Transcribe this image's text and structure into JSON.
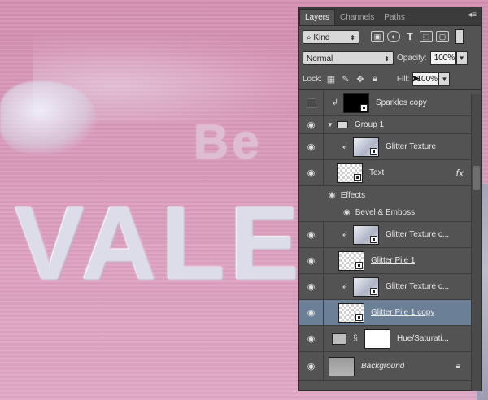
{
  "canvas": {
    "text_be": "Be",
    "text_main": "VALEN"
  },
  "panel": {
    "tabs": [
      {
        "label": "Layers",
        "active": true
      },
      {
        "label": "Channels",
        "active": false
      },
      {
        "label": "Paths",
        "active": false
      }
    ],
    "filter": {
      "kind_label": "Kind",
      "icons": [
        "image-filter-icon",
        "adjustment-filter-icon",
        "type-filter-icon",
        "shape-filter-icon",
        "smart-object-filter-icon"
      ]
    },
    "blend": {
      "mode": "Normal",
      "opacity_label": "Opacity:",
      "opacity_value": "100%"
    },
    "lock": {
      "label": "Lock:",
      "fill_label": "Fill:",
      "fill_value": "100%"
    },
    "layers": [
      {
        "name": "Sparkles copy",
        "visible": false,
        "clipped": true,
        "thumb": "black"
      },
      {
        "name": "Group 1",
        "visible": true,
        "type": "group"
      },
      {
        "name": "Glitter Texture",
        "visible": true,
        "clipped": true,
        "thumb": "texture"
      },
      {
        "name": "Text",
        "visible": true,
        "thumb": "checker",
        "fx": "fx"
      },
      {
        "name": "Effects",
        "type": "effects-header"
      },
      {
        "name": "Bevel & Emboss",
        "type": "effect"
      },
      {
        "name": "Glitter Texture c...",
        "visible": true,
        "clipped": true,
        "thumb": "texture"
      },
      {
        "name": "Glitter Pile 1",
        "visible": true,
        "thumb": "checker"
      },
      {
        "name": "Glitter Texture c...",
        "visible": true,
        "clipped": true,
        "thumb": "texture"
      },
      {
        "name": "Glitter Pile 1 copy",
        "visible": true,
        "thumb": "checker",
        "selected": true
      },
      {
        "name": "Hue/Saturati...",
        "visible": true,
        "type": "adjustment"
      },
      {
        "name": "Background",
        "visible": true,
        "thumb": "gray",
        "locked": true
      }
    ]
  }
}
